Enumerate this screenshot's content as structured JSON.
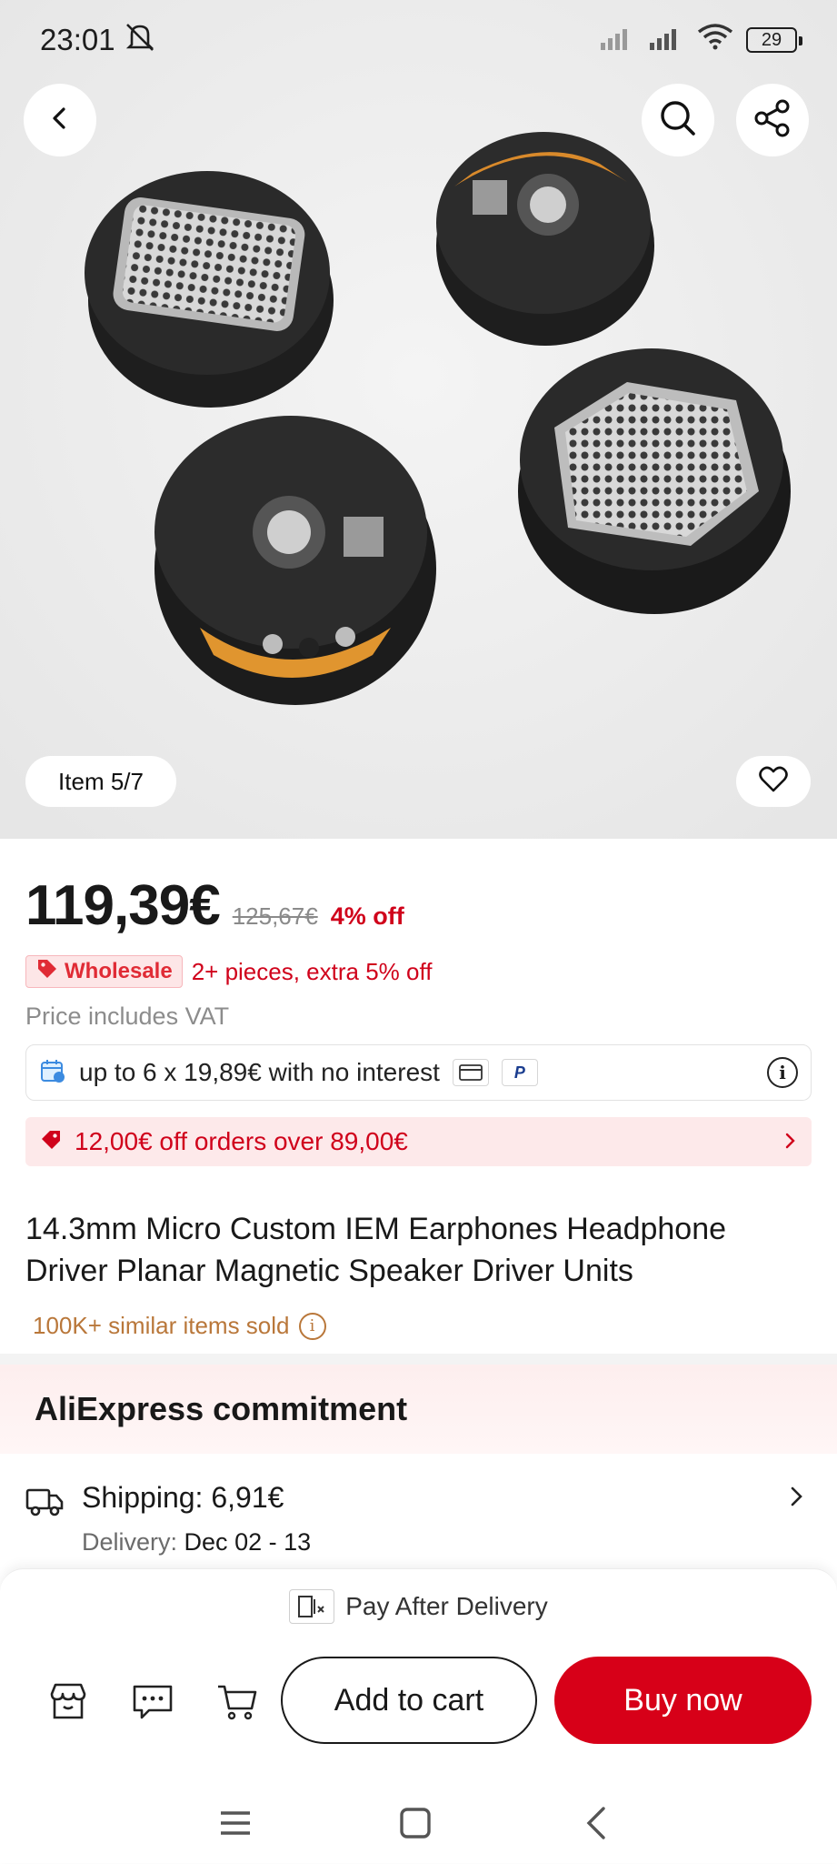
{
  "status_bar": {
    "time": "23:01",
    "battery": "29"
  },
  "hero": {
    "item_counter": "Item 5/7"
  },
  "price": {
    "current": "119,39€",
    "original": "125,67€",
    "discount": "4% off"
  },
  "wholesale": {
    "badge": "Wholesale",
    "text": "2+ pieces, extra 5% off"
  },
  "vat_note": "Price includes VAT",
  "installments": {
    "text": "up to 6 x 19,89€ with no interest"
  },
  "coupon": {
    "text": "12,00€ off orders over 89,00€"
  },
  "product": {
    "title": "14.3mm Micro Custom IEM Earphones Headphone Driver Planar Magnetic Speaker Driver Units",
    "sold": "100K+ similar items sold"
  },
  "commitment": {
    "title": "AliExpress commitment"
  },
  "shipping": {
    "label": "Shipping: 6,91€",
    "delivery_label": "Delivery:",
    "delivery_dates": "Dec 02 - 13"
  },
  "bottom": {
    "pay_after_delivery": "Pay After Delivery",
    "add_to_cart": "Add to cart",
    "buy_now": "Buy now"
  },
  "colors": {
    "accent": "#d70018",
    "sold_text": "#b9773a"
  }
}
